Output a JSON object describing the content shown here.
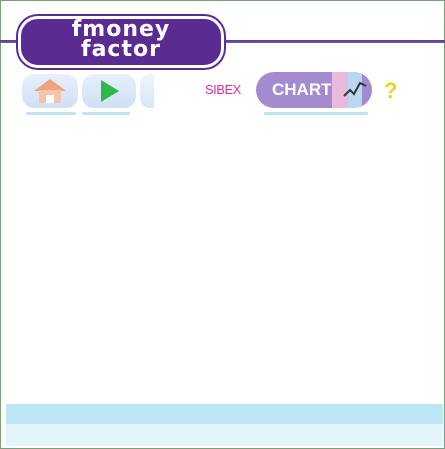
{
  "logo": {
    "line1": "fmoney",
    "line2": "factor"
  },
  "toolbar": {
    "home_icon": "house-icon",
    "play_icon": "play-triangle-icon",
    "sibex_label": "SIBEX",
    "chart_label": "CHART",
    "chart_icon": "line-chart-icon",
    "help_icon": "question-mark-icon"
  },
  "colors": {
    "brand_purple": "#5a2c92",
    "chart_button": "#a48bd0",
    "sibex_pink": "#e0309a",
    "play_green": "#2fb84a",
    "help_yellow": "#f0d21a",
    "footer_blue": "#bde6f4"
  }
}
